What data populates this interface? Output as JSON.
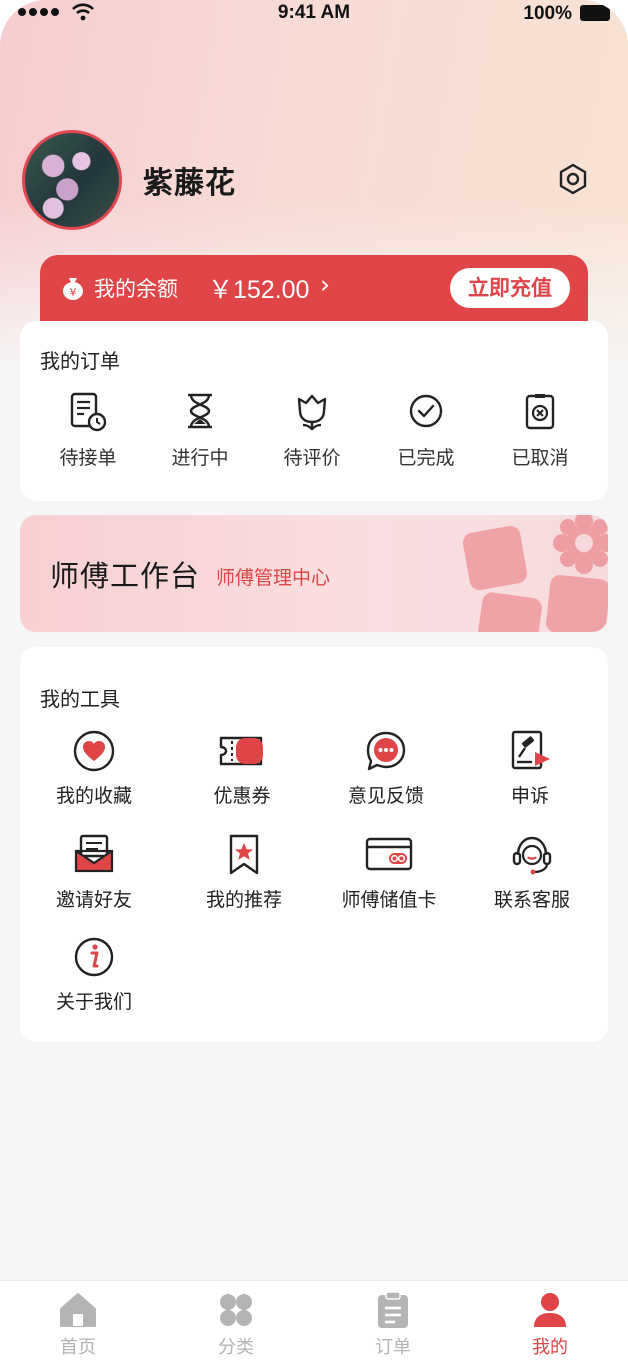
{
  "status_bar": {
    "time": "9:41 AM",
    "battery": "100%"
  },
  "profile": {
    "name": "紫藤花"
  },
  "balance": {
    "label": "我的余额",
    "amount": "￥152.00",
    "chevron": "›",
    "recharge_label": "立即充值"
  },
  "orders": {
    "title": "我的订单",
    "items": [
      {
        "label": "待接单",
        "icon": "pending-order-icon"
      },
      {
        "label": "进行中",
        "icon": "hourglass-icon"
      },
      {
        "label": "待评价",
        "icon": "flower-icon"
      },
      {
        "label": "已完成",
        "icon": "check-circle-icon"
      },
      {
        "label": "已取消",
        "icon": "cancel-box-icon"
      }
    ]
  },
  "workbench": {
    "title": "师傅工作台",
    "subtitle": "师傅管理中心"
  },
  "tools": {
    "title": "我的工具",
    "items": [
      {
        "label": "我的收藏",
        "icon": "heart-icon"
      },
      {
        "label": "优惠券",
        "icon": "coupon-icon"
      },
      {
        "label": "意见反馈",
        "icon": "feedback-bubble-icon"
      },
      {
        "label": "申诉",
        "icon": "appeal-gavel-icon"
      },
      {
        "label": "邀请好友",
        "icon": "invite-mail-icon"
      },
      {
        "label": "我的推荐",
        "icon": "bookmark-star-icon"
      },
      {
        "label": "师傅储值卡",
        "icon": "stored-value-card-icon"
      },
      {
        "label": "联系客服",
        "icon": "headset-icon"
      },
      {
        "label": "关于我们",
        "icon": "info-icon"
      }
    ]
  },
  "tabbar": {
    "items": [
      {
        "label": "首页",
        "icon": "home-icon",
        "active": false
      },
      {
        "label": "分类",
        "icon": "category-icon",
        "active": false
      },
      {
        "label": "订单",
        "icon": "clipboard-icon",
        "active": false
      },
      {
        "label": "我的",
        "icon": "user-icon",
        "active": true
      }
    ]
  },
  "colors": {
    "accent": "#df4447",
    "text": "#222222",
    "inactive": "#b4b4b4",
    "background": "#f6f6f6"
  }
}
